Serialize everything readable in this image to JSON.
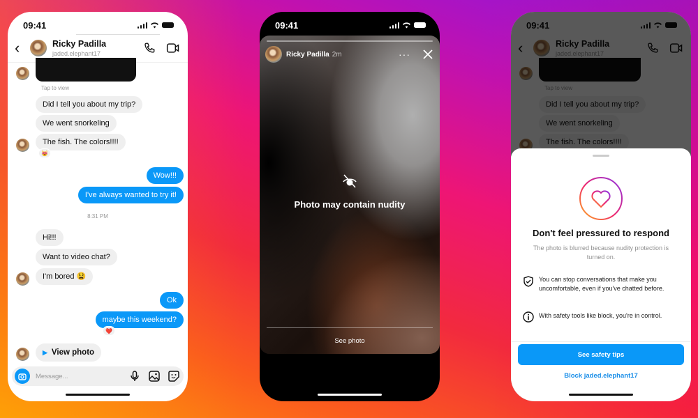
{
  "background": {
    "gradient": [
      "#8a17e0",
      "#c011b0",
      "#ee1575",
      "#f22a3e",
      "#fb5a1e",
      "#fe9a0a"
    ]
  },
  "colors": {
    "accent_blue": "#0a98f8",
    "bubble_gray": "#efefef",
    "link_blue": "#1a8ee8"
  },
  "status_bar": {
    "time": "09:41"
  },
  "chat_screen": {
    "header": {
      "name": "Ricky Padilla",
      "username": "jaded.elephant17",
      "back_icon": "chevron-left-icon",
      "call_icon": "phone-icon",
      "video_icon": "video-camera-icon"
    },
    "photo_caption": "Tap to view",
    "messages": [
      {
        "from": "them",
        "text": "Did I tell you about my trip?"
      },
      {
        "from": "them",
        "text": "We went snorkeling"
      },
      {
        "from": "them",
        "text": "The fish. The colors!!!!",
        "reaction": "😻"
      },
      {
        "from": "me",
        "text": "Wow!!!"
      },
      {
        "from": "me",
        "text": "I've always wanted to try it!"
      },
      {
        "from": "timestamp",
        "text": "8:31 PM"
      },
      {
        "from": "them",
        "text": "Hi!!!"
      },
      {
        "from": "them",
        "text": "Want to video chat?"
      },
      {
        "from": "them",
        "text": "I'm bored 😫"
      },
      {
        "from": "me",
        "text": "Ok"
      },
      {
        "from": "me",
        "text": "maybe this weekend?",
        "reaction": "❤️"
      },
      {
        "from": "them",
        "text": "View photo",
        "type": "view-once"
      }
    ],
    "input": {
      "placeholder": "Message...",
      "icons": [
        "camera-icon",
        "microphone-icon",
        "gallery-icon",
        "sticker-icon"
      ]
    }
  },
  "story_screen": {
    "author": "Ricky Padilla",
    "age": "2m",
    "more_icon": "ellipsis-icon",
    "close_icon": "close-icon",
    "warning_icon": "eye-slash-icon",
    "warning_text": "Photo may contain nudity",
    "see_photo": "See photo"
  },
  "safety_sheet": {
    "title": "Don't feel pressured to respond",
    "subtitle": "The photo is blurred because nudity protection is turned on.",
    "items": [
      {
        "icon": "shield-check-icon",
        "text": "You can stop conversations that make you uncomfortable, even if you've chatted before."
      },
      {
        "icon": "info-icon",
        "text": "With safety tools like block, you're in control."
      }
    ],
    "primary_button": "See safety tips",
    "block_link": "Block jaded.elephant17"
  }
}
